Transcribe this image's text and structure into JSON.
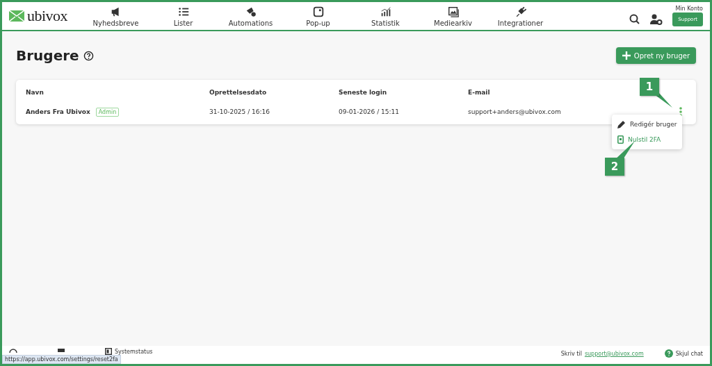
{
  "header": {
    "logo": "ubivox",
    "nav": [
      "Nyhedsbreve",
      "Lister",
      "Automations",
      "Pop-up",
      "Statistik",
      "Mediearkiv",
      "Integrationer"
    ],
    "account": "Min Konto",
    "support_button": "Support"
  },
  "page": {
    "title": "Brugere",
    "create_button": "Opret ny bruger"
  },
  "table": {
    "columns": [
      "Navn",
      "Oprettelsesdato",
      "Seneste login",
      "E-mail"
    ],
    "rows": [
      {
        "name": "Anders Fra Ubivox",
        "badge": "Admin",
        "created": "31-10-2025 / 16:16",
        "last_login": "09-01-2026 / 15:11",
        "email": "support+anders@ubivox.com"
      }
    ]
  },
  "menu": {
    "items": [
      {
        "label": "Redigér bruger",
        "kind": "edit"
      },
      {
        "label": "Nulstil 2FA",
        "kind": "reset"
      }
    ]
  },
  "callouts": [
    "1",
    "2"
  ],
  "footer": {
    "links": [
      "Systemstatus"
    ],
    "write_to": "Skriv til",
    "email": "support@ubivox.com",
    "hide_chat": "Skjul chat"
  },
  "status_url": "https://app.ubivox.com/settings/reset2fa"
}
